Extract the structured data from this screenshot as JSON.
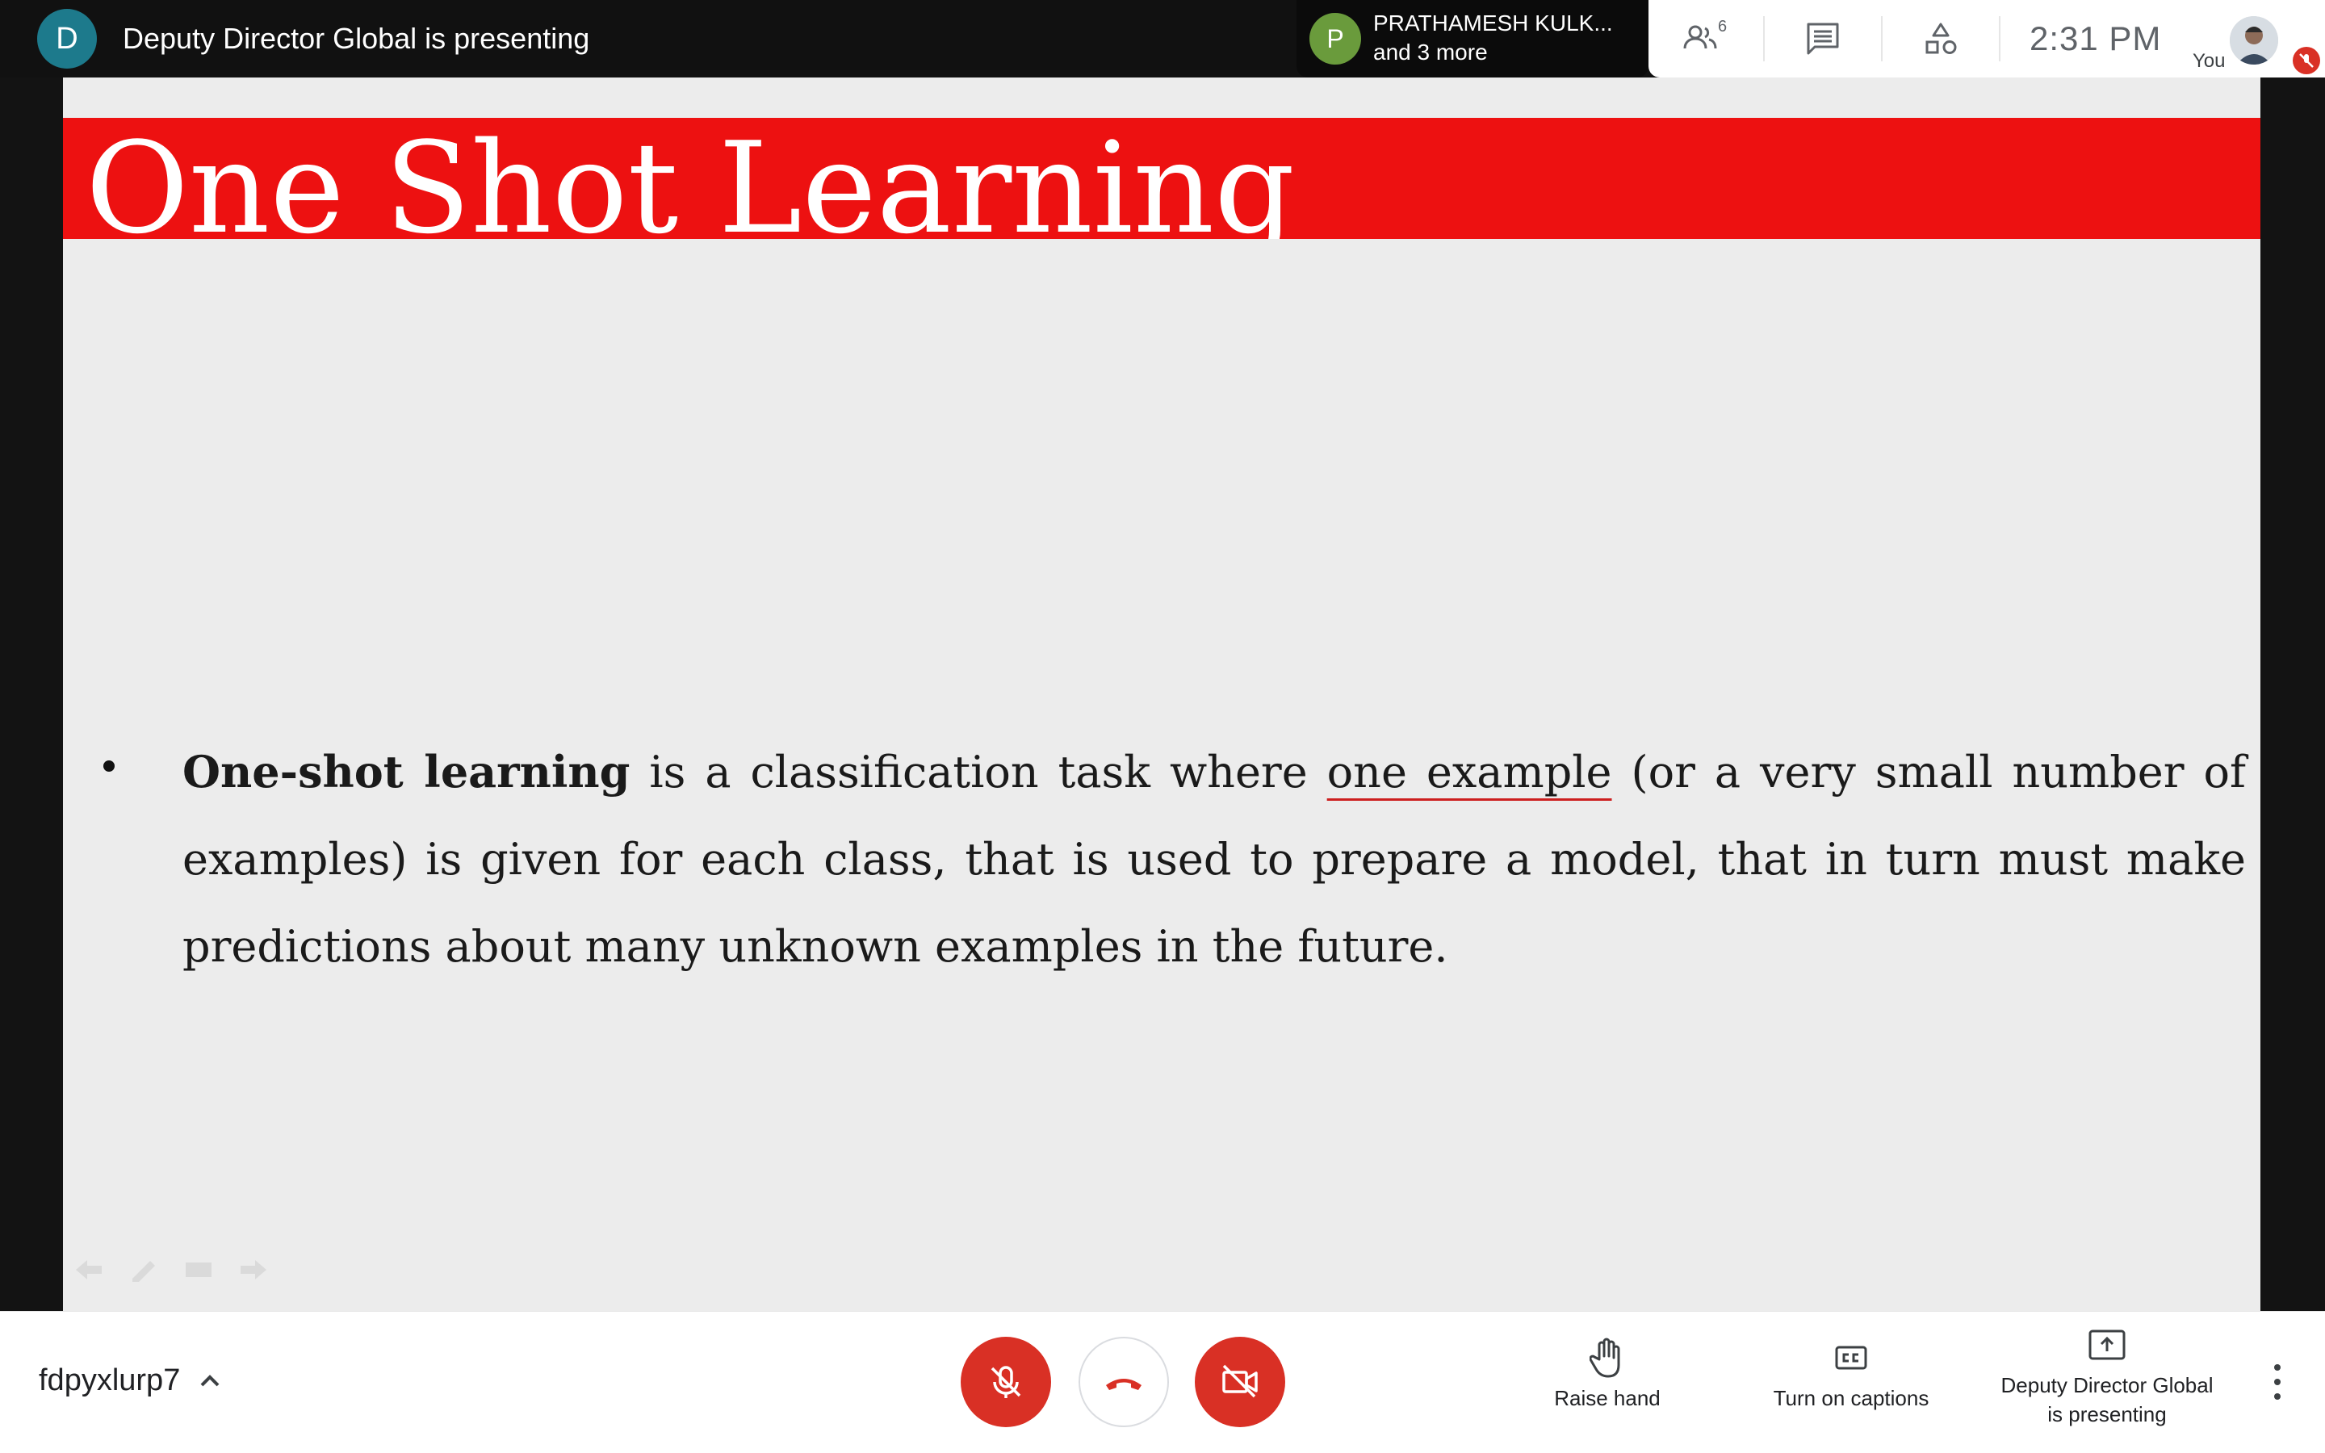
{
  "topbar": {
    "presenter_initial": "D",
    "presenter_text": "Deputy Director Global is presenting",
    "participant_initial": "P",
    "participant_name": "PRATHAMESH KULK...",
    "participant_more": "and 3 more",
    "people_count": "6",
    "time": "2:31  PM",
    "self_label": "You"
  },
  "slide": {
    "title": "One Shot Learning",
    "bullet": {
      "bold_lead": "One-shot learning",
      "text_before_underline": " is a classification task where ",
      "underlined": "one example",
      "text_after_underline": " (or a very small number of examples) is given for each class, that is used to prepare a model, that in turn must make predictions about many unknown examples in the future."
    }
  },
  "bottombar": {
    "meeting_code": "fdpyxlurp7",
    "raise_hand": "Raise hand",
    "captions": "Turn on captions",
    "presenting_line1": "Deputy Director Global",
    "presenting_line2": "is presenting"
  },
  "colors": {
    "title_band": "#ed1111",
    "control_red": "#d93025",
    "presenter_avatar": "#1d7a8c",
    "participant_avatar": "#6a9b3c"
  }
}
